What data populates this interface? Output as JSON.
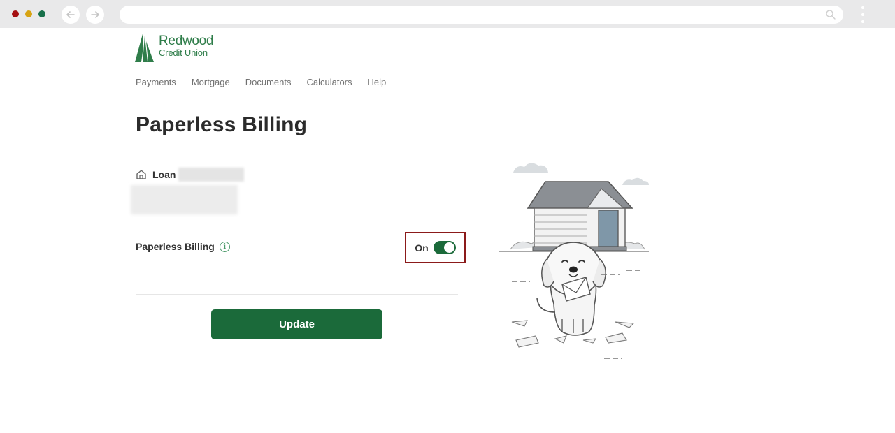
{
  "browser": {
    "address": ""
  },
  "brand": {
    "name": "Redwood",
    "subtitle": "Credit Union",
    "color": "#2f7d4a"
  },
  "nav": {
    "items": [
      "Payments",
      "Mortgage",
      "Documents",
      "Calculators",
      "Help"
    ]
  },
  "page": {
    "title": "Paperless Billing"
  },
  "account": {
    "type_label": "Loan",
    "icon": "home-icon"
  },
  "setting": {
    "label": "Paperless Billing",
    "info_icon": "info-icon",
    "toggle_label": "On",
    "toggle_state": true
  },
  "actions": {
    "update_label": "Update"
  },
  "colors": {
    "primary": "#1b6a3a",
    "highlight_border": "#8b1a1a"
  }
}
